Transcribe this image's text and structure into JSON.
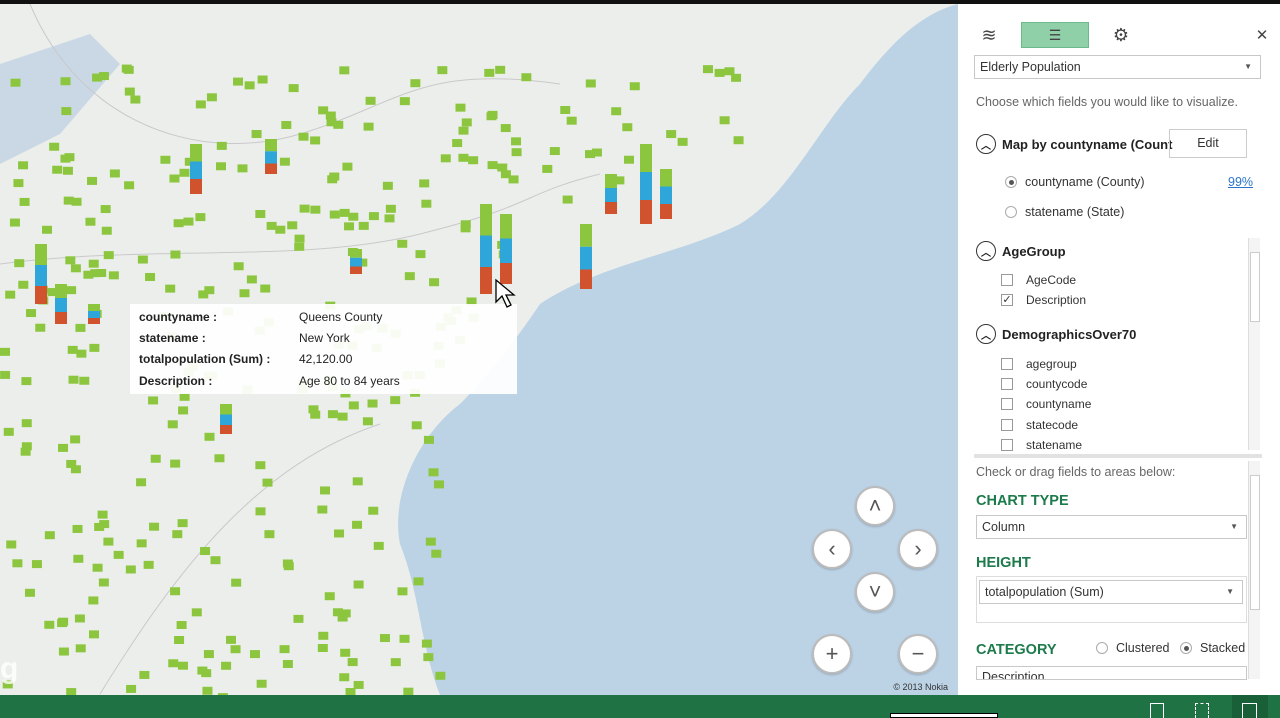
{
  "map": {
    "tooltip": [
      {
        "key": "countyname :",
        "value": "Queens County"
      },
      {
        "key": "statename :",
        "value": "New York"
      },
      {
        "key": "totalpopulation (Sum) :",
        "value": "42,120.00"
      },
      {
        "key": "Description :",
        "value": "Age 80 to 84 years"
      }
    ],
    "copyright": "© 2013 Nokia",
    "watermark": "g",
    "colors": {
      "ocean": "#b9cfe3",
      "land": "#eceeec",
      "bar_green": "#8cc63f",
      "bar_blue": "#2fa6d9",
      "bar_red": "#d0532e"
    }
  },
  "nav": {
    "up": "˄",
    "down": "˅",
    "left": "‹",
    "right": "›",
    "zoom_in": "+",
    "zoom_out": "−"
  },
  "panel": {
    "tabs": [
      {
        "icon": "layers-icon",
        "glyph": "≋"
      },
      {
        "icon": "field-list-icon",
        "glyph": "☰",
        "active": true
      },
      {
        "icon": "gear-icon",
        "glyph": "⚙"
      }
    ],
    "close": "✕",
    "layer": "Elderly Population",
    "choose_hint": "Choose which fields you would like to visualize.",
    "map_by": {
      "label": "Map by countyname (Count",
      "edit": "Edit",
      "options": [
        {
          "label": "countyname (County)",
          "selected": true,
          "confidence": "99%"
        },
        {
          "label": "statename (State)",
          "selected": false
        }
      ]
    },
    "tables": [
      {
        "name": "AgeGroup",
        "fields": [
          {
            "label": "AgeCode",
            "checked": false
          },
          {
            "label": "Description",
            "checked": true
          }
        ]
      },
      {
        "name": "DemographicsOver70",
        "fields": [
          {
            "label": "agegroup",
            "checked": false
          },
          {
            "label": "countycode",
            "checked": false
          },
          {
            "label": "countyname",
            "checked": false
          },
          {
            "label": "statecode",
            "checked": false
          },
          {
            "label": "statename",
            "checked": false
          }
        ]
      }
    ],
    "drag_hint": "Check or drag fields to areas below:",
    "chart_type_label": "CHART TYPE",
    "chart_type": "Column",
    "height_label": "HEIGHT",
    "height_field": "totalpopulation (Sum)",
    "category_label": "CATEGORY",
    "clustered": "Clustered",
    "stacked": "Stacked",
    "stack_mode": "Stacked",
    "category_field": "Description"
  }
}
